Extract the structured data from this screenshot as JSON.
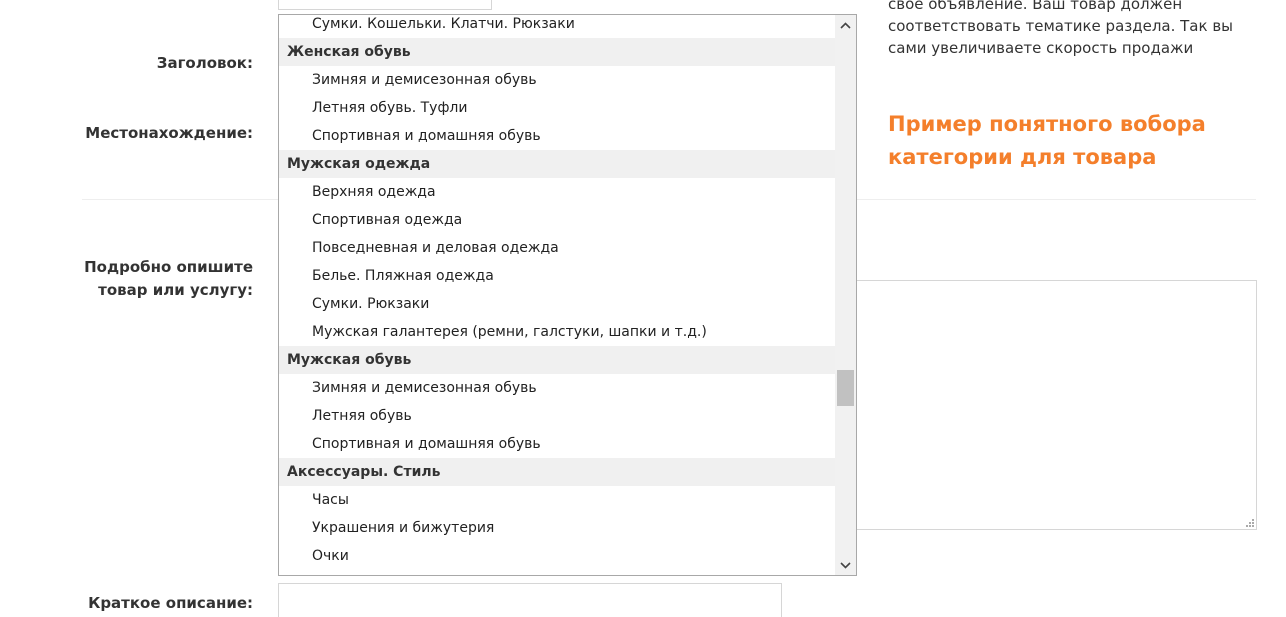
{
  "labels": {
    "title": "Заголовок:",
    "location": "Местонахождение:",
    "describe": "Подробно опишите товар или услугу:",
    "short": "Краткое описание:"
  },
  "hint": {
    "text": "свое объявление. Ваш товар должен соответствовать тематике раздела. Так вы сами увеличиваете скорость продажи",
    "promo": "Пример понятного вобора категории для товара"
  },
  "colors": {
    "accent": "#f47f2b",
    "group_bg": "#f0f0f0"
  },
  "scrollbar": {
    "up_icon": "chevron-up-icon",
    "down_icon": "chevron-down-icon"
  },
  "dropdown": {
    "items": [
      {
        "type": "item",
        "label": "Сумки. Кошельки. Клатчи. Рюкзаки"
      },
      {
        "type": "group",
        "label": "Женская обувь"
      },
      {
        "type": "item",
        "label": "Зимняя и демисезонная обувь"
      },
      {
        "type": "item",
        "label": "Летняя обувь. Туфли"
      },
      {
        "type": "item",
        "label": "Спортивная и домашняя обувь"
      },
      {
        "type": "group",
        "label": "Мужская одежда"
      },
      {
        "type": "item",
        "label": "Верхняя одежда"
      },
      {
        "type": "item",
        "label": "Спортивная одежда"
      },
      {
        "type": "item",
        "label": "Повседневная и деловая одежда"
      },
      {
        "type": "item",
        "label": "Белье. Пляжная одежда"
      },
      {
        "type": "item",
        "label": "Сумки. Рюкзаки"
      },
      {
        "type": "item",
        "label": "Мужская галантерея (ремни, галстуки, шапки и т.д.)"
      },
      {
        "type": "group",
        "label": "Мужская обувь"
      },
      {
        "type": "item",
        "label": "Зимняя и демисезонная обувь"
      },
      {
        "type": "item",
        "label": "Летняя обувь"
      },
      {
        "type": "item",
        "label": "Спортивная и домашняя обувь"
      },
      {
        "type": "group",
        "label": "Аксессуары. Стиль"
      },
      {
        "type": "item",
        "label": "Часы"
      },
      {
        "type": "item",
        "label": "Украшения и бижутерия"
      },
      {
        "type": "item",
        "label": "Очки"
      }
    ]
  }
}
